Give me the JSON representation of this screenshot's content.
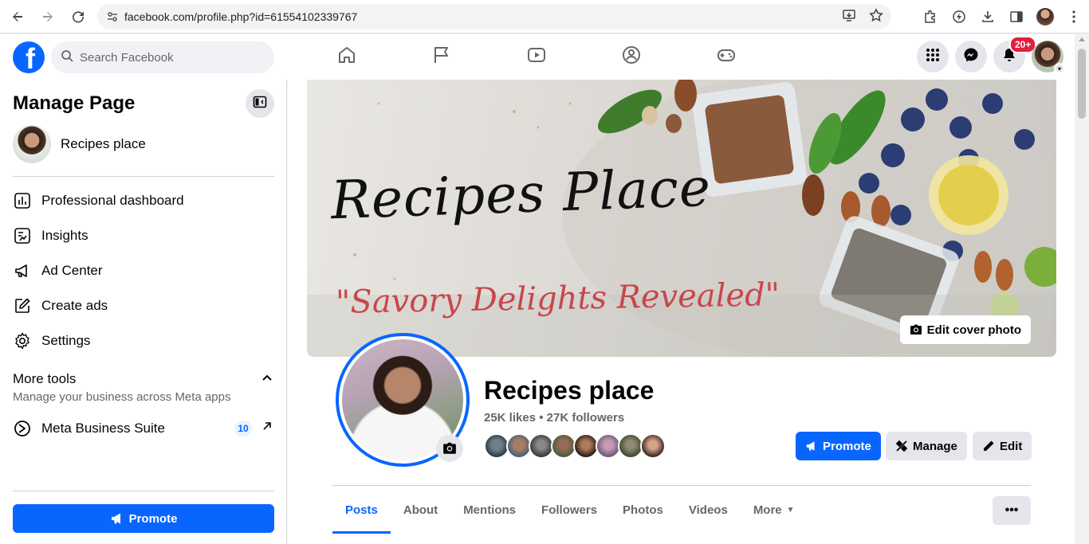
{
  "browser": {
    "url": "facebook.com/profile.php?id=61554102339767"
  },
  "fb": {
    "logo": "f",
    "search_placeholder": "Search Facebook",
    "nav_tabs": [
      "home-icon",
      "flag-icon",
      "video-icon",
      "groups-icon",
      "gaming-icon"
    ],
    "notifications_badge": "20+"
  },
  "sidebar": {
    "title": "Manage Page",
    "page_name": "Recipes place",
    "items": [
      {
        "label": "Professional dashboard",
        "icon": "dashboard-icon"
      },
      {
        "label": "Insights",
        "icon": "insights-icon"
      },
      {
        "label": "Ad Center",
        "icon": "megaphone-icon"
      },
      {
        "label": "Create ads",
        "icon": "pencil-square-icon"
      },
      {
        "label": "Settings",
        "icon": "gear-icon"
      }
    ],
    "more_tools_title": "More tools",
    "more_tools_subtitle": "Manage your business across Meta apps",
    "meta_business_suite": "Meta Business Suite",
    "meta_business_suite_count": "10",
    "promote_label": "Promote"
  },
  "cover": {
    "title_script": "Recipes Place",
    "slogan": "\"Savory Delights Revealed\"",
    "edit_cover_label": "Edit cover photo"
  },
  "profile": {
    "name": "Recipes place",
    "stats": "25K likes • 27K followers",
    "promote_label": "Promote",
    "manage_label": "Manage",
    "edit_label": "Edit"
  },
  "tabs": [
    {
      "label": "Posts",
      "active": true
    },
    {
      "label": "About",
      "active": false
    },
    {
      "label": "Mentions",
      "active": false
    },
    {
      "label": "Followers",
      "active": false
    },
    {
      "label": "Photos",
      "active": false
    },
    {
      "label": "Videos",
      "active": false
    },
    {
      "label": "More",
      "active": false
    }
  ],
  "tabs_more_label": "•••",
  "colors": {
    "brand": "#0866ff",
    "badge": "#e41e3f"
  }
}
